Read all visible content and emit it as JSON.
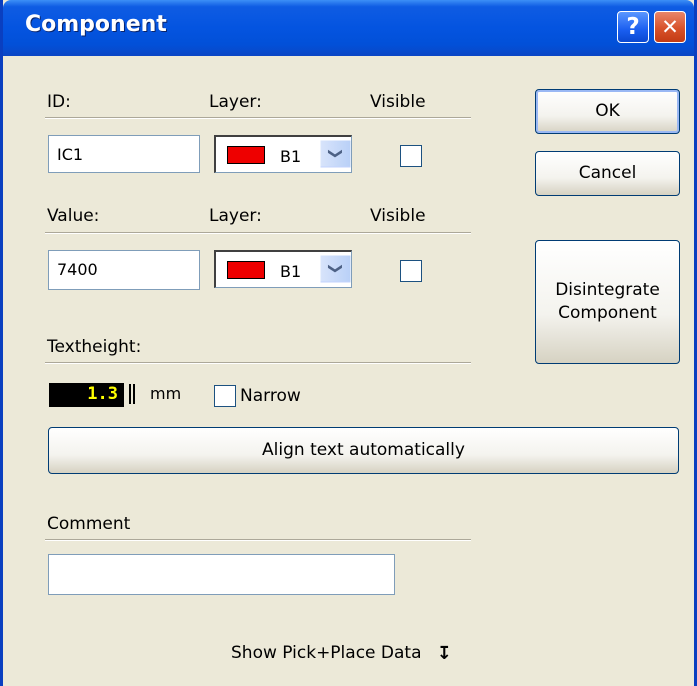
{
  "window": {
    "title": "Component"
  },
  "title_buttons": {
    "help": "?",
    "close": "✕"
  },
  "id_section": {
    "id_label": "ID:",
    "layer_label": "Layer:",
    "visible_label": "Visible",
    "id_value": "IC1",
    "layer_value": "B1",
    "layer_color": "#ee0000",
    "visible": false
  },
  "value_section": {
    "value_label": "Value:",
    "layer_label": "Layer:",
    "visible_label": "Visible",
    "value_value": "7400",
    "layer_value": "B1",
    "layer_color": "#ee0000",
    "visible": false
  },
  "textheight": {
    "label": "Textheight:",
    "value": "1.3",
    "unit": "mm",
    "narrow_label": "Narrow",
    "narrow_checked": false
  },
  "buttons": {
    "ok": "OK",
    "cancel": "Cancel",
    "disintegrate_line1": "Disintegrate",
    "disintegrate_line2": "Component",
    "align": "Align text automatically"
  },
  "comment": {
    "label": "Comment",
    "value": ""
  },
  "footer": {
    "pick_place_label": "Show Pick+Place Data",
    "arrow_icon": "arrow-down-icon"
  },
  "colors": {
    "titlebar": "#0454e0",
    "dialog_bg": "#ece9d8",
    "layer_swatch": "#ee0000",
    "spin_text": "#ffff00"
  }
}
